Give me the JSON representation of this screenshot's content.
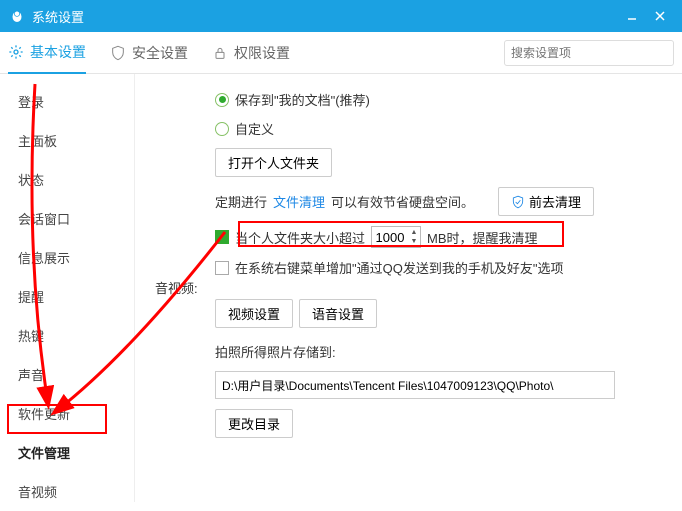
{
  "titlebar": {
    "title": "系统设置"
  },
  "tabs": {
    "basic": "基本设置",
    "security": "安全设置",
    "permission": "权限设置"
  },
  "search": {
    "placeholder": "搜索设置项"
  },
  "sidebar": {
    "items": [
      "登录",
      "主面板",
      "状态",
      "会话窗口",
      "信息展示",
      "提醒",
      "热键",
      "声音",
      "软件更新",
      "文件管理",
      "音视频"
    ]
  },
  "content": {
    "save_docs": "保存到\"我的文档\"(推荐)",
    "custom": "自定义",
    "open_folder": "打开个人文件夹",
    "cleanup_pre": "定期进行",
    "cleanup_link": "文件清理",
    "cleanup_post": "可以有效节省硬盘空间。",
    "cleanup_btn": "前去清理",
    "size_pre": "当个人文件夹大小超过",
    "size_value": "1000",
    "size_unit": "MB时，提醒我清理",
    "context_menu": "在系统右键菜单增加\"通过QQ发送到我的手机及好友\"选项",
    "av_label": "音视频:",
    "video_settings": "视频设置",
    "voice_settings": "语音设置",
    "photo_label": "拍照所得照片存储到:",
    "photo_path": "D:\\用户目录\\Documents\\Tencent Files\\1047009123\\QQ\\Photo\\",
    "change_dir": "更改目录"
  }
}
